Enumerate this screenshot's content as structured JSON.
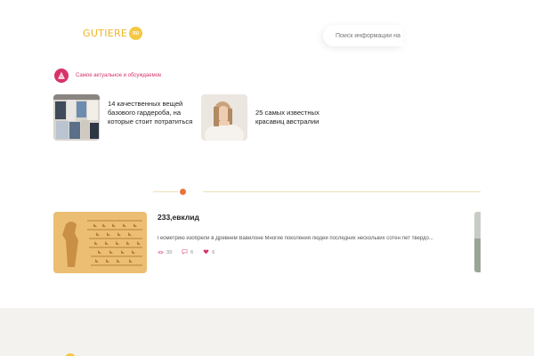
{
  "header": {
    "logo_text": "GUTIERE",
    "logo_badge": "RU",
    "search_placeholder": "Поиск информации на"
  },
  "trending": {
    "title": "Самое актуальное и обсуждаемое",
    "icon": "flame-icon",
    "cards": [
      {
        "title": "14 качественных вещей базового гардероба, на которые стоит потратиться",
        "image": "clothes-rack-photo"
      },
      {
        "title": "25 самых известных красавиц австралии",
        "image": "woman-portrait-photo"
      }
    ]
  },
  "article": {
    "title": "233,евклид",
    "excerpt": "Геометрию изобрели в Древнем Вавилоне Многие поколения людей последних нескольких сотен лет твердо...",
    "views": "33",
    "comments": "6",
    "likes": "6",
    "image": "cuneiform-tablet-photo"
  },
  "colors": {
    "logo": "#f0b429",
    "accent": "#d7336b",
    "divider_dot": "#e8733a",
    "footer_bg": "#f3f2ef"
  }
}
